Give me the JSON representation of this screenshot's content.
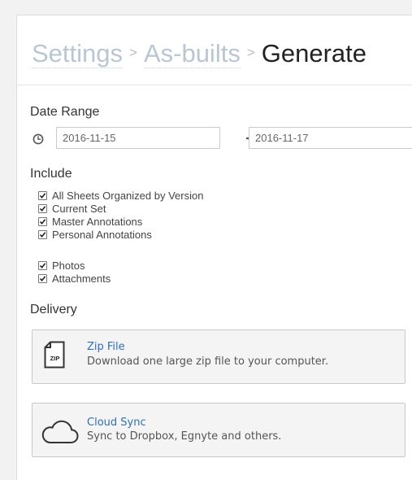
{
  "breadcrumb": {
    "items": [
      {
        "label": "Settings"
      },
      {
        "label": "As-builts"
      }
    ],
    "separator": ">",
    "current": "Generate"
  },
  "date_range": {
    "label": "Date Range",
    "start": "2016-11-15",
    "end": "2016-11-17"
  },
  "include": {
    "label": "Include",
    "group1": [
      {
        "label": "All Sheets Organized by Version",
        "checked": true
      },
      {
        "label": "Current Set",
        "checked": true
      },
      {
        "label": "Master Annotations",
        "checked": true
      },
      {
        "label": "Personal Annotations",
        "checked": true
      }
    ],
    "group2": [
      {
        "label": "Photos",
        "checked": true
      },
      {
        "label": "Attachments",
        "checked": true
      }
    ]
  },
  "delivery": {
    "label": "Delivery",
    "options": [
      {
        "title": "Zip File",
        "description": "Download one large zip file to your computer.",
        "icon": "zip-file-icon",
        "icon_text": "ZIP"
      },
      {
        "title": "Cloud Sync",
        "description": "Sync to Dropbox, Egnyte and others.",
        "icon": "cloud-icon"
      }
    ]
  },
  "colors": {
    "link_title": "#2f6fb5",
    "breadcrumb_link": "#b9c6d3",
    "card_bg": "#f4f4f4"
  }
}
